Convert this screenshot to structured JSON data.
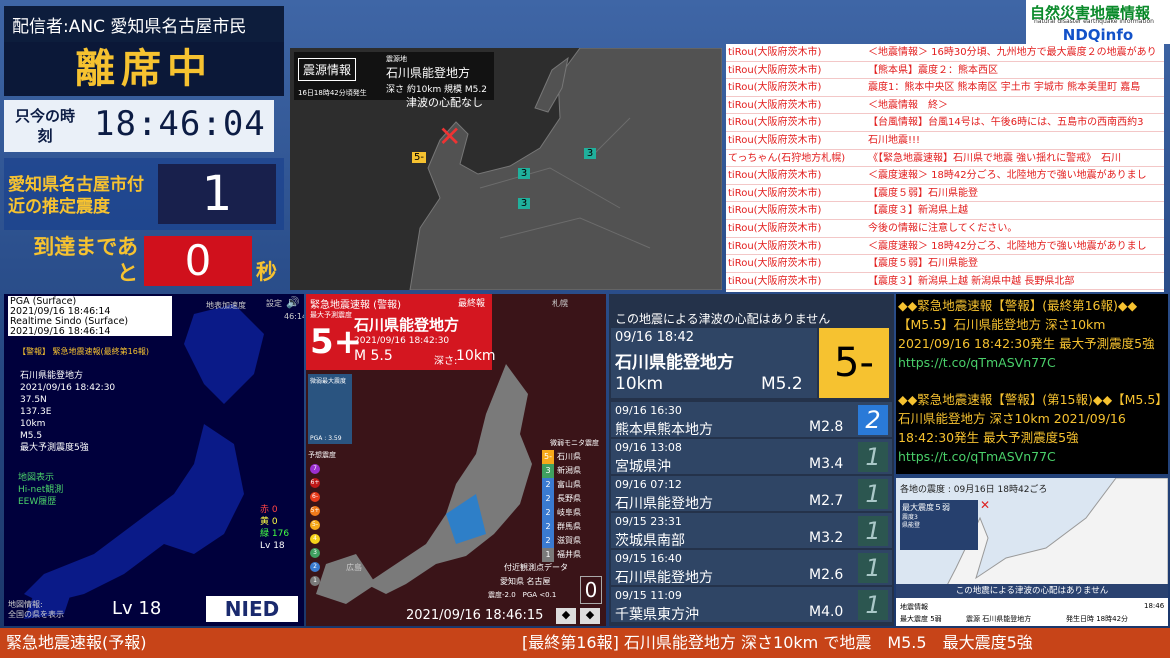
{
  "header": {
    "distributor": "配信者:ANC 愛知県名古屋市民",
    "status": "離席中",
    "time_label": "只今の時刻",
    "time_value": "18:46:04",
    "intensity_label": "愛知県名古屋市付近の推定震度",
    "intensity_value": "1",
    "arrival_label": "到達まであと",
    "arrival_value": "0",
    "arrival_unit": "秒"
  },
  "logo": {
    "line1": "自然災害地震情報",
    "sub": "natural disaster earthquake information",
    "line2": "NDQinfo"
  },
  "epicenter": {
    "tag": "震源情報",
    "issued": "16日18時42分頃発生",
    "region_label": "震源地",
    "region": "石川県能登地方",
    "depth": "深さ 約10km",
    "magnitude": "規模 M5.2",
    "tsunami": "津波の心配なし",
    "station_marks": [
      "5-",
      "3",
      "3",
      "3"
    ]
  },
  "chat": [
    {
      "user": "tiRou(大阪府茨木市)",
      "msg": "＜地震情報＞ 16時30分頃、九州地方で最大震度２の地震があり"
    },
    {
      "user": "tiRou(大阪府茨木市)",
      "msg": "【熊本県】震度２：熊本西区"
    },
    {
      "user": "tiRou(大阪府茨木市)",
      "msg": "震度1：熊本中央区 熊本南区 宇土市 宇城市 熊本美里町 嘉島"
    },
    {
      "user": "tiRou(大阪府茨木市)",
      "msg": "＜地震情報　終＞"
    },
    {
      "user": "tiRou(大阪府茨木市)",
      "msg": "【台風情報】台風14号は、午後6時には、五島市の西南西約3"
    },
    {
      "user": "tiRou(大阪府茨木市)",
      "msg": "石川地震!!!"
    },
    {
      "user": "てっちゃん(石狩地方札幌)",
      "msg": "《【緊急地震速報】石川県で地震 強い揺れに警戒》　石川"
    },
    {
      "user": "tiRou(大阪府茨木市)",
      "msg": "＜震度速報＞ 18時42分ごろ、北陸地方で強い地震がありまし"
    },
    {
      "user": "tiRou(大阪府茨木市)",
      "msg": "【震度５弱】石川県能登"
    },
    {
      "user": "tiRou(大阪府茨木市)",
      "msg": "【震度３】新潟県上越"
    },
    {
      "user": "tiRou(大阪府茨木市)",
      "msg": "今後の情報に注意してください。"
    },
    {
      "user": "tiRou(大阪府茨木市)",
      "msg": "＜震度速報＞ 18時42分ごろ、北陸地方で強い地震がありまし"
    },
    {
      "user": "tiRou(大阪府茨木市)",
      "msg": "【震度５弱】石川県能登"
    },
    {
      "user": "tiRou(大阪府茨木市)",
      "msg": "【震度３】新潟県上越 新潟県中越 長野県北部"
    }
  ],
  "kmon": {
    "hd1": "PGA (Surface)",
    "hd2": "2021/09/16 18:46:14",
    "hd3": "Realtime Sindo (Surface)",
    "hd4": "2021/09/16 18:46:14",
    "top_right": "地表加速度",
    "setting": "設定",
    "clock": "46:14",
    "eew_title": "【警報】 緊急地震速報(最終第16報)",
    "info": [
      "石川県能登地方",
      "2021/09/16 18:42:30",
      "37.5N",
      "137.3E",
      "10km",
      "M5.5",
      "最大予測震度5強"
    ],
    "options": [
      "地図表示",
      "Hi-net観測",
      "EEW履歴"
    ],
    "counts": [
      {
        "k": "赤",
        "v": "0"
      },
      {
        "k": "黄",
        "v": "0"
      },
      {
        "k": "緑",
        "v": "176"
      }
    ],
    "lv_small": "Lv 18",
    "lv": "Lv 18",
    "footer1": "地図情報:",
    "footer2": "全国の県を表示",
    "logo": "NIED"
  },
  "eew": {
    "title": "緊急地震速報 (警報)",
    "final": "最終報",
    "sublabel": "最大予測震度",
    "intensity": "5+",
    "region": "石川県能登地方",
    "time": "2021/09/16 18:42:30",
    "mag": "M 5.5",
    "depth_label": "深さ:",
    "depth": "10km",
    "city_top": "札幌",
    "pga_label": "微弱最大震度",
    "pga": "PGA : 3.59",
    "legend_title": "予想震度",
    "scale_levels": [
      "7",
      "6+",
      "6-",
      "5+",
      "5-",
      "4",
      "3",
      "2",
      "1"
    ],
    "monitor_title": "微弱モニタ震度",
    "monitor": [
      {
        "i": "5-",
        "p": "石川県"
      },
      {
        "i": "3",
        "p": "新潟県"
      },
      {
        "i": "2",
        "p": "富山県"
      },
      {
        "i": "2",
        "p": "長野県"
      },
      {
        "i": "2",
        "p": "岐阜県"
      },
      {
        "i": "2",
        "p": "群馬県"
      },
      {
        "i": "2",
        "p": "滋賀県"
      },
      {
        "i": "1",
        "p": "福井県"
      }
    ],
    "near_label": "付近観測点データ",
    "near_place": "愛知県 名古屋",
    "near_vals": "震度-2.0　PGA <0.1",
    "near_value": "0",
    "city_hiroshima": "広島",
    "clock": "2021/09/16 18:46:15"
  },
  "qlist": {
    "tsunami": "この地震による津波の心配はありません",
    "top": {
      "dt": "09/16 18:42",
      "place": "石川県能登地方",
      "depth": "10km",
      "mag": "M5.2",
      "int": "5-"
    },
    "rows": [
      {
        "dt": "09/16 16:30",
        "place": "熊本県熊本地方",
        "mag": "M2.8",
        "int": "2"
      },
      {
        "dt": "09/16 13:08",
        "place": "宮城県沖",
        "mag": "M3.4",
        "int": "1"
      },
      {
        "dt": "09/16 07:12",
        "place": "石川県能登地方",
        "mag": "M2.7",
        "int": "1"
      },
      {
        "dt": "09/15 23:31",
        "place": "茨城県南部",
        "mag": "M3.2",
        "int": "1"
      },
      {
        "dt": "09/15 16:40",
        "place": "石川県能登地方",
        "mag": "M2.6",
        "int": "1"
      },
      {
        "dt": "09/15 11:09",
        "place": "千葉県東方沖",
        "mag": "M4.0",
        "int": "1"
      }
    ]
  },
  "twitter": {
    "post1": "◆◆緊急地震速報【警報】(最終第16報)◆◆【M5.5】石川県能登地方 深さ10km 2021/09/16 18:42:30発生 最大予測震度5強",
    "link1": "https://t.co/qTmASVn77C",
    "post2": "◆◆緊急地震速報【警報】(第15報)◆◆【M5.5】石川県能登地方 深さ10km 2021/09/16 18:42:30発生 最大予測震度5強",
    "link2": "https://t.co/qTmASVn77C"
  },
  "mini": {
    "hd": "各地の震度 : 09月16日 18時42ごろ",
    "box_title": "最大震度５弱",
    "tsunami": "この地震による津波の心配はありません",
    "f1": "地震情報",
    "f2": "最大震度 5弱",
    "f3": "震源 石川県能登地方",
    "f4": "発生日時 18時42分",
    "b1": "震度3",
    "b2": "県能登",
    "clock": "18:46"
  },
  "ticker": {
    "left": "緊急地震速報(予報)",
    "right": "[最終第16報] 石川県能登地方 深さ10km で地震　M5.5　最大震度5強"
  },
  "colors": {
    "accent": "#f6c230",
    "alert_red": "#d41620",
    "chat_red": "#e21c1c",
    "ticker": "#c74418"
  }
}
